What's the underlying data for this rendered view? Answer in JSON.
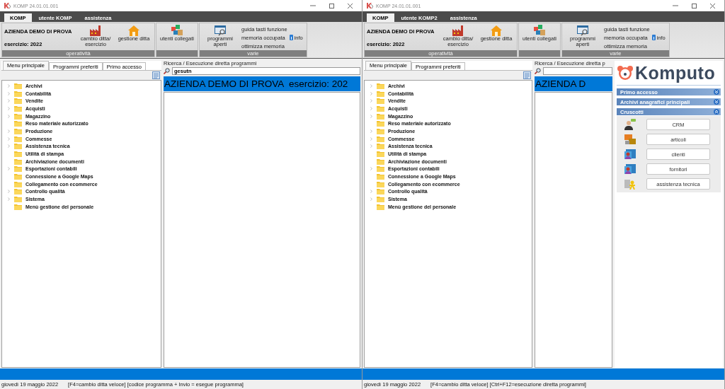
{
  "windows": [
    {
      "title": "KOMP 24.01.01.001",
      "ribbon_tabs": [
        {
          "label": "KOMP",
          "selected": true
        },
        {
          "label": "utente KOMP",
          "selected": false
        },
        {
          "label": "assistenza",
          "selected": false
        }
      ],
      "ribbon_groups": [
        {
          "label": "operatività",
          "items": [
            {
              "kind": "company",
              "name": "AZIENDA DEMO DI PROVA",
              "year": "esercizio: 2022"
            },
            {
              "kind": "factory",
              "label": "cambio ditta/ esercizio"
            },
            {
              "kind": "house",
              "label": "gestione ditta"
            }
          ]
        },
        {
          "items": [
            {
              "kind": "users",
              "label": "utenti collegati"
            }
          ]
        },
        {
          "label": "varie",
          "items": [
            {
              "kind": "window",
              "label": "programmi aperti"
            },
            {
              "kind": "links",
              "links": [
                "guida tasti funzione",
                "memoria occupata",
                "ottimizza memoria"
              ]
            },
            {
              "kind": "info",
              "label": "info"
            }
          ]
        }
      ],
      "side_tabs": [
        {
          "label": "Menu principale",
          "selected": true
        },
        {
          "label": "Programmi preferiti",
          "selected": false
        },
        {
          "label": "Primo accesso",
          "selected": false
        }
      ],
      "tree": [
        {
          "label": "Archivi",
          "has_children": true
        },
        {
          "label": "Contabilità",
          "has_children": true
        },
        {
          "label": "Vendite",
          "has_children": true
        },
        {
          "label": "Acquisti",
          "has_children": true
        },
        {
          "label": "Magazzino",
          "has_children": true
        },
        {
          "label": "Reso materiale autorizzato",
          "has_children": false
        },
        {
          "label": "Produzione",
          "has_children": true
        },
        {
          "label": "Commesse",
          "has_children": true
        },
        {
          "label": "Assistenza tecnica",
          "has_children": true
        },
        {
          "label": "Utilità di stampa",
          "has_children": false
        },
        {
          "label": "Archiviazione documenti",
          "has_children": false
        },
        {
          "label": "Esportazioni contabili",
          "has_children": true
        },
        {
          "label": "Connessione a Google Maps",
          "has_children": false
        },
        {
          "label": "Collegamento con ecommerce",
          "has_children": false
        },
        {
          "label": "Controllo qualità",
          "has_children": true
        },
        {
          "label": "Sistema",
          "has_children": true
        },
        {
          "label": "Menù gestione del personale",
          "has_children": false
        }
      ],
      "search": {
        "label": "Ricerca / Esecuzione diretta programmi",
        "value": "gesutn"
      },
      "banner": "AZIENDA DEMO DI PROVA  esercizio: 202",
      "status": {
        "date": "giovedì 19 maggio 2022",
        "hint": "[F4=cambio ditta veloce] [codice programma + Invio = esegue programma]"
      }
    },
    {
      "title": "KOMP 24.01.01.001",
      "ribbon_tabs": [
        {
          "label": "KOMP",
          "selected": true
        },
        {
          "label": "utente KOMP2",
          "selected": false
        },
        {
          "label": "assistenza",
          "selected": false
        }
      ],
      "ribbon_groups": [
        {
          "label": "operatività",
          "items": [
            {
              "kind": "company",
              "name": "AZIENDA DEMO DI PROVA",
              "year": "esercizio: 2022"
            },
            {
              "kind": "factory",
              "label": "cambio ditta/ esercizio"
            },
            {
              "kind": "house",
              "label": "gestione ditta"
            }
          ]
        },
        {
          "items": [
            {
              "kind": "users",
              "label": "utenti collegati"
            }
          ]
        },
        {
          "label": "varie",
          "items": [
            {
              "kind": "window",
              "label": "programmi aperti"
            },
            {
              "kind": "links",
              "links": [
                "guida tasti funzione",
                "memoria occupata",
                "ottimizza memoria"
              ]
            },
            {
              "kind": "info",
              "label": "info"
            }
          ]
        }
      ],
      "side_tabs": [
        {
          "label": "Menu principale",
          "selected": true
        },
        {
          "label": "Programmi preferiti",
          "selected": false
        }
      ],
      "tree": [
        {
          "label": "Archivi",
          "has_children": true
        },
        {
          "label": "Contabilità",
          "has_children": true
        },
        {
          "label": "Vendite",
          "has_children": true
        },
        {
          "label": "Acquisti",
          "has_children": true
        },
        {
          "label": "Magazzino",
          "has_children": true
        },
        {
          "label": "Reso materiale autorizzato",
          "has_children": false
        },
        {
          "label": "Produzione",
          "has_children": true
        },
        {
          "label": "Commesse",
          "has_children": true
        },
        {
          "label": "Assistenza tecnica",
          "has_children": true
        },
        {
          "label": "Utilità di stampa",
          "has_children": false
        },
        {
          "label": "Archiviazione documenti",
          "has_children": false
        },
        {
          "label": "Esportazioni contabili",
          "has_children": true
        },
        {
          "label": "Connessione a Google Maps",
          "has_children": false
        },
        {
          "label": "Collegamento con ecommerce",
          "has_children": false
        },
        {
          "label": "Controllo qualità",
          "has_children": true
        },
        {
          "label": "Sistema",
          "has_children": true
        },
        {
          "label": "Menù gestione del personale",
          "has_children": false
        }
      ],
      "search": {
        "label": "Ricerca / Esecuzione diretta p"
      },
      "banner": "AZIENDA D",
      "dashboard": {
        "logo": "Komputo",
        "sections": [
          {
            "title": "Primo accesso",
            "expanded": false
          },
          {
            "title": "Archivi anagrafici principali",
            "expanded": false
          },
          {
            "title": "Cruscotti",
            "expanded": true,
            "buttons": [
              {
                "kind": "person",
                "label": "CRM"
              },
              {
                "kind": "goods",
                "label": "articoli"
              },
              {
                "kind": "card",
                "label": "clienti"
              },
              {
                "kind": "card",
                "label": "fornitori"
              },
              {
                "kind": "support",
                "label": "assistenza tecnica"
              }
            ]
          }
        ]
      },
      "status": {
        "date": "giovedì 19 maggio 2022",
        "hint": "[F4=cambio ditta veloce] [Ctrl+F12=esecuzione diretta programmi]"
      }
    }
  ]
}
